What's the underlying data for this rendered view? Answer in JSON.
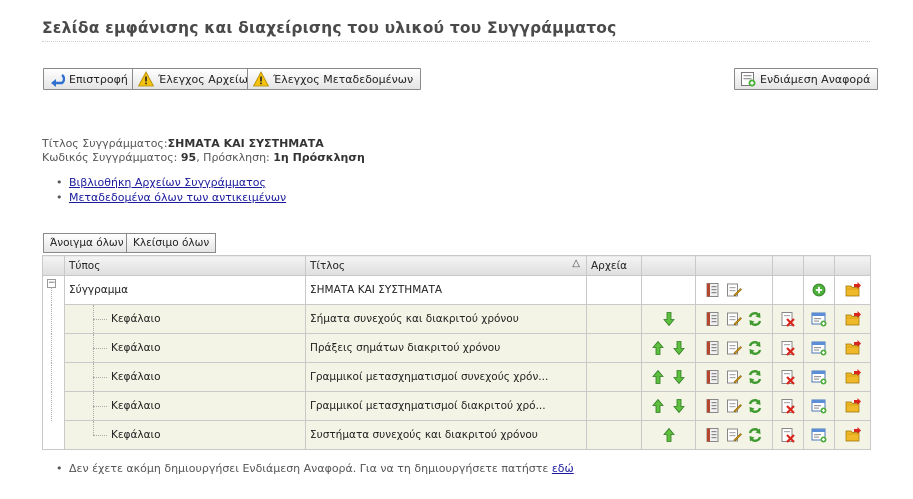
{
  "page_title": "Σελίδα εμφάνισης και διαχείρισης του υλικού του Συγγράμματος",
  "toolbar": {
    "back_label": "Επιστροφή",
    "check_files_label": "Έλεγχος Αρχείων",
    "check_metadata_label": "Έλεγχος Μεταδεδομένων",
    "interim_report_label": "Ενδιάμεση Αναφορά"
  },
  "info": {
    "title_label": "Τίτλος Συγγράμματος:",
    "title_value": "ΣΗΜΑΤΑ ΚΑΙ ΣΥΣΤΗΜΑΤΑ",
    "code_label": "Κωδικός Συγγράμματος:",
    "code_value": "95",
    "call_label": ", Πρόσκληση:",
    "call_value": "1η Πρόσκληση"
  },
  "links": [
    "Βιβλιοθήκη Αρχείων Συγγράμματος",
    "Μεταδεδομένα όλων των αντικειμένων"
  ],
  "grid_buttons": {
    "expand_all": "Άνοιγμα όλων",
    "collapse_all": "Κλείσιμο όλων"
  },
  "table": {
    "headers": {
      "type": "Τύπος",
      "title": "Τίτλος",
      "files": "Αρχεία"
    },
    "sort_indicator": "△",
    "rows": [
      {
        "type": "Σύγγραμμα",
        "title": "ΣΗΜΑΤΑ ΚΑΙ ΣΥΣΤΗΜΑΤΑ"
      },
      {
        "type": "Κεφάλαιο",
        "title": "Σήματα συνεχούς και διακριτού χρόνου"
      },
      {
        "type": "Κεφάλαιο",
        "title": "Πράξεις σημάτων διακριτού χρόνου"
      },
      {
        "type": "Κεφάλαιο",
        "title": "Γραμμικοί μετασχηματισμοί συνεχούς χρόν..."
      },
      {
        "type": "Κεφάλαιο",
        "title": "Γραμμικοί μετασχηματισμοί διακριτού χρό..."
      },
      {
        "type": "Κεφάλαιο",
        "title": "Συστήματα συνεχούς και διακριτού χρόνου"
      }
    ]
  },
  "footer": {
    "text": "Δεν έχετε ακόμη δημιουργήσει Ενδιάμεση Αναφορά. Για να τη δημιουργήσετε πατήστε ",
    "link": "εδώ"
  }
}
